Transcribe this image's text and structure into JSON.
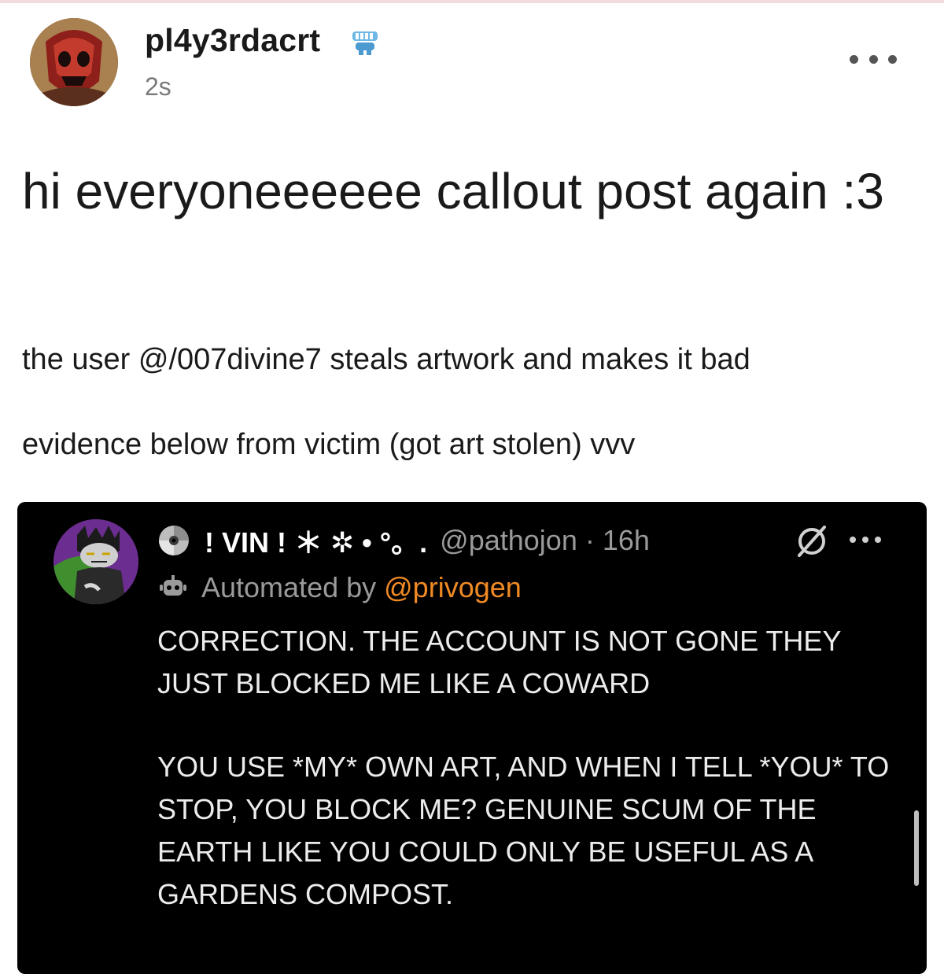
{
  "post": {
    "username": "pl4y3rdacrt",
    "timestamp": "2s",
    "title": "hi everyoneeeeee callout post again :3",
    "body_line1": "the user @/007divine7 steals artwork and makes it bad",
    "body_line2": "evidence below from victim (got art stolen) vvv"
  },
  "embed": {
    "display_name": "! VIN ! ＊ ✲ • °。.",
    "handle_meta": "@pathojon · 16h",
    "automated_by": "Automated by",
    "automator": "@privogen",
    "text_para1": "CORRECTION. THE ACCOUNT IS NOT GONE THEY JUST BLOCKED ME LIKE A COWARD",
    "text_para2": "YOU USE *MY* OWN ART, AND WHEN I TELL *YOU* TO STOP, YOU BLOCK ME? GENUINE SCUM OF THE EARTH LIKE YOU COULD ONLY BE USEFUL AS A GARDENS COMPOST."
  },
  "icons": {
    "verified": "teeth-badge-icon",
    "more": "more-dots-icon",
    "disc": "cd-icon",
    "bot": "robot-icon",
    "block": "block-icon"
  },
  "colors": {
    "link": "#f08a24",
    "embed_bg": "#000000",
    "muted": "#9a9a9a"
  }
}
